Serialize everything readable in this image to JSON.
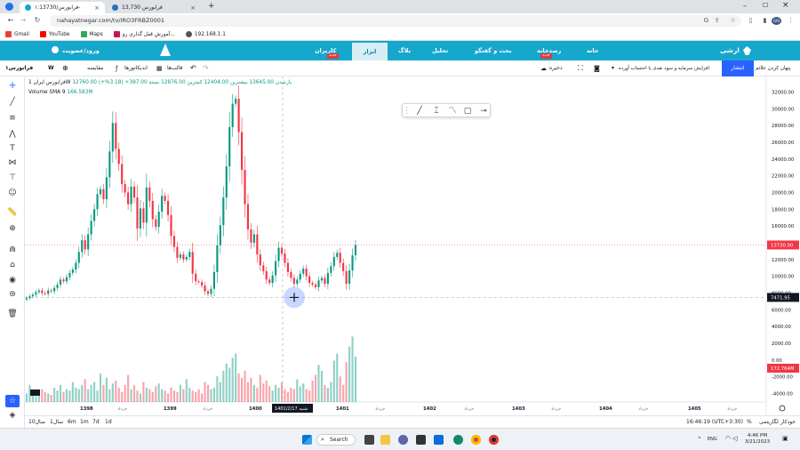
{
  "browser": {
    "tabs": [
      {
        "title": "فرابورس/۱:13730-",
        "active": true
      },
      {
        "title": "فرابورس 13,730",
        "active": false
      }
    ],
    "url": "nahayatnegar.com/tv/IRO3FRBZ0001",
    "profile": "GRI"
  },
  "bookmarks": [
    {
      "label": "Gmail",
      "color": "#ea4335"
    },
    {
      "label": "YouTube",
      "color": "#ff0000"
    },
    {
      "label": "Maps",
      "color": "#34a853"
    },
    {
      "label": "آموزش قفل گذاری رو...",
      "color": "#c2185b"
    },
    {
      "label": "192.168.1.1",
      "color": "#555555"
    }
  ],
  "site_nav": {
    "logo": "ارشی",
    "items": [
      "خانه",
      "رصدخانه",
      "بحث و گفتگو",
      "تحلیل",
      "بلاگ",
      "ابزار",
      "کاربران"
    ],
    "login": "ورود/عضویت",
    "badge_text": "جدید"
  },
  "chart_toolbar": {
    "symbol": "فرابورس۱",
    "interval": "W",
    "compare": "مقایسه",
    "indicators": "اندیکاتورها",
    "templates": "قالب‌ها",
    "save": "ذخیره",
    "strategy": "افزایش سرمایه و سود نقدی یا احتساب آورده",
    "publish": "انتشار",
    "hide": "پنهان کردن علائم"
  },
  "legend": {
    "title": "فرابورس ایران",
    "interval": "1W",
    "text": "12760.00 بازشدن 13645.00 بیشترین 12404.00 کمترین 12876.00 بسته 397.00+ (3.18%+)",
    "volume_label": "Volume SMA 9",
    "volume_value": "166.583M"
  },
  "price_axis": {
    "ticks": [
      32000,
      30000,
      28000,
      26000,
      24000,
      22000,
      20000,
      18000,
      16000,
      14000,
      12000,
      10000,
      8000,
      6000,
      4000,
      2000,
      0,
      -2000,
      -4000
    ],
    "last_price": "13730.00",
    "crosshair_price": "7471.95",
    "volume_badge": "172.764M"
  },
  "time_axis": {
    "labels": [
      "1398",
      "خرداد",
      "1399",
      "خرداد",
      "1400",
      "خرداد",
      "1401",
      "خرداد",
      "1402",
      "خرداد",
      "1403",
      "خرداد",
      "1404",
      "خرداد",
      "1405",
      "خرداد"
    ],
    "crosshair_date": "شنبه   1401/2/17"
  },
  "range_bar": {
    "ranges": [
      "10سال",
      "1سال",
      "6m",
      "1m",
      "7d",
      "1d"
    ],
    "time": "16:46:19 (UTC+3:30)",
    "percent": "%",
    "log": "لگاریتمی",
    "auto": "خودکار"
  },
  "taskbar": {
    "search": "Search",
    "time": "4:46 PM",
    "date": "3/21/2023",
    "lang": "ENG"
  },
  "chart_data": {
    "type": "candlestick",
    "y_range": [
      -4800,
      33000
    ],
    "note_units": "price in rials",
    "closes": [
      7400,
      7600,
      7800,
      8100,
      8300,
      8000,
      7900,
      8300,
      8200,
      8600,
      9000,
      9600,
      9400,
      9900,
      10400,
      10800,
      11600,
      12900,
      14300,
      13200,
      15000,
      16600,
      18000,
      19800,
      20400,
      19200,
      21800,
      24900,
      28300,
      25200,
      23400,
      21000,
      20000,
      18600,
      20700,
      19400,
      15700,
      18100,
      16400,
      20600,
      19000,
      16800,
      15900,
      17700,
      19600,
      19000,
      17300,
      14800,
      13500,
      12200,
      12600,
      12000,
      12300,
      12900,
      10300,
      9400,
      9300,
      8900,
      8200,
      7900,
      8500,
      10500,
      13700,
      16100,
      19400,
      23100,
      27800,
      30600,
      31200,
      27200,
      22700,
      18600,
      15600,
      14000,
      15000,
      12600,
      11300,
      10600,
      9600,
      9200,
      10100,
      11800,
      13400,
      12700,
      11600,
      10500,
      9800,
      9100,
      9600,
      10300,
      10900,
      10000,
      9200,
      9000,
      8700,
      9500,
      9800,
      9100,
      10400,
      11200,
      12300,
      12800,
      11600,
      10600,
      9100,
      10700,
      12500,
      13730
    ],
    "volumes": [
      6,
      12,
      8,
      4,
      5,
      9,
      7,
      6,
      5,
      10,
      8,
      12,
      7,
      9,
      8,
      14,
      10,
      9,
      12,
      16,
      9,
      12,
      14,
      8,
      20,
      12,
      17,
      9,
      13,
      15,
      10,
      7,
      12,
      19,
      9,
      12,
      8,
      6,
      14,
      10,
      9,
      7,
      11,
      13,
      9,
      8,
      6,
      10,
      8,
      7,
      12,
      9,
      16,
      10,
      8,
      7,
      9,
      6,
      14,
      12,
      9,
      10,
      18,
      14,
      22,
      27,
      24,
      31,
      34,
      20,
      17,
      22,
      14,
      17,
      12,
      10,
      19,
      13,
      15,
      11,
      8,
      12,
      10,
      14,
      9,
      7,
      10,
      9,
      16,
      11,
      13,
      9,
      8,
      15,
      19,
      26,
      22,
      12,
      10,
      14,
      29,
      34,
      18,
      12,
      28,
      39,
      46,
      32
    ]
  }
}
